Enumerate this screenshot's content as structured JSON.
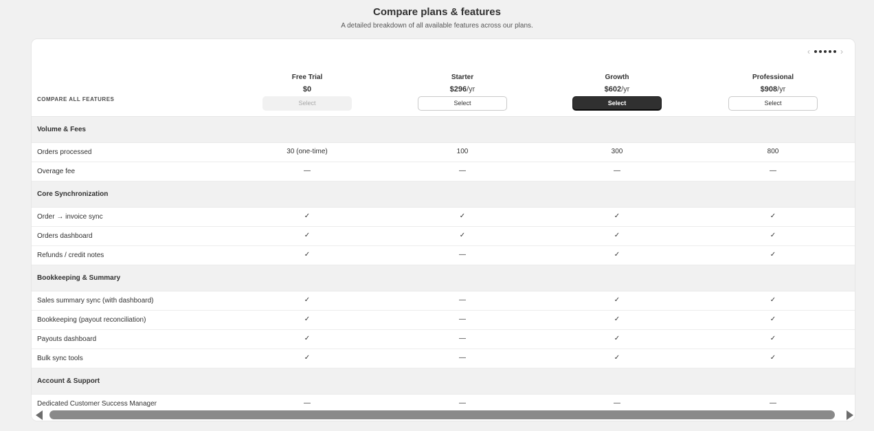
{
  "header": {
    "title": "Compare plans & features",
    "subtitle": "A detailed breakdown of all available features across our plans."
  },
  "pager": {
    "prev": "‹",
    "next": "›",
    "dots": 5
  },
  "compare_label": "COMPARE ALL FEATURES",
  "plans": [
    {
      "name": "Free Trial",
      "price": "$0",
      "period": "",
      "button": "Select",
      "state": "disabled"
    },
    {
      "name": "Starter",
      "price": "$296",
      "period": "/yr",
      "button": "Select",
      "state": "default"
    },
    {
      "name": "Growth",
      "price": "$602",
      "period": "/yr",
      "button": "Select",
      "state": "primary"
    },
    {
      "name": "Professional",
      "price": "$908",
      "period": "/yr",
      "button": "Select",
      "state": "default"
    }
  ],
  "sections": [
    {
      "title": "Volume & Fees",
      "rows": [
        {
          "feature": "Orders processed",
          "values": [
            "30 (one-time)",
            "100",
            "300",
            "800"
          ]
        },
        {
          "feature": "Overage fee",
          "values": [
            "—",
            "—",
            "—",
            "—"
          ]
        }
      ]
    },
    {
      "title": "Core Synchronization",
      "rows": [
        {
          "feature": "Order → invoice sync",
          "values": [
            "✓",
            "✓",
            "✓",
            "✓"
          ]
        },
        {
          "feature": "Orders dashboard",
          "values": [
            "✓",
            "✓",
            "✓",
            "✓"
          ]
        },
        {
          "feature": "Refunds / credit notes",
          "values": [
            "✓",
            "—",
            "✓",
            "✓"
          ]
        }
      ]
    },
    {
      "title": "Bookkeeping & Summary",
      "rows": [
        {
          "feature": "Sales summary sync (with dashboard)",
          "values": [
            "✓",
            "—",
            "✓",
            "✓"
          ]
        },
        {
          "feature": "Bookkeeping (payout reconciliation)",
          "values": [
            "✓",
            "—",
            "✓",
            "✓"
          ]
        },
        {
          "feature": "Payouts dashboard",
          "values": [
            "✓",
            "—",
            "✓",
            "✓"
          ]
        },
        {
          "feature": "Bulk sync tools",
          "values": [
            "✓",
            "—",
            "✓",
            "✓"
          ]
        }
      ]
    },
    {
      "title": "Account & Support",
      "rows": [
        {
          "feature": "Dedicated Customer Success Manager",
          "values": [
            "—",
            "—",
            "—",
            "—"
          ]
        }
      ]
    }
  ]
}
